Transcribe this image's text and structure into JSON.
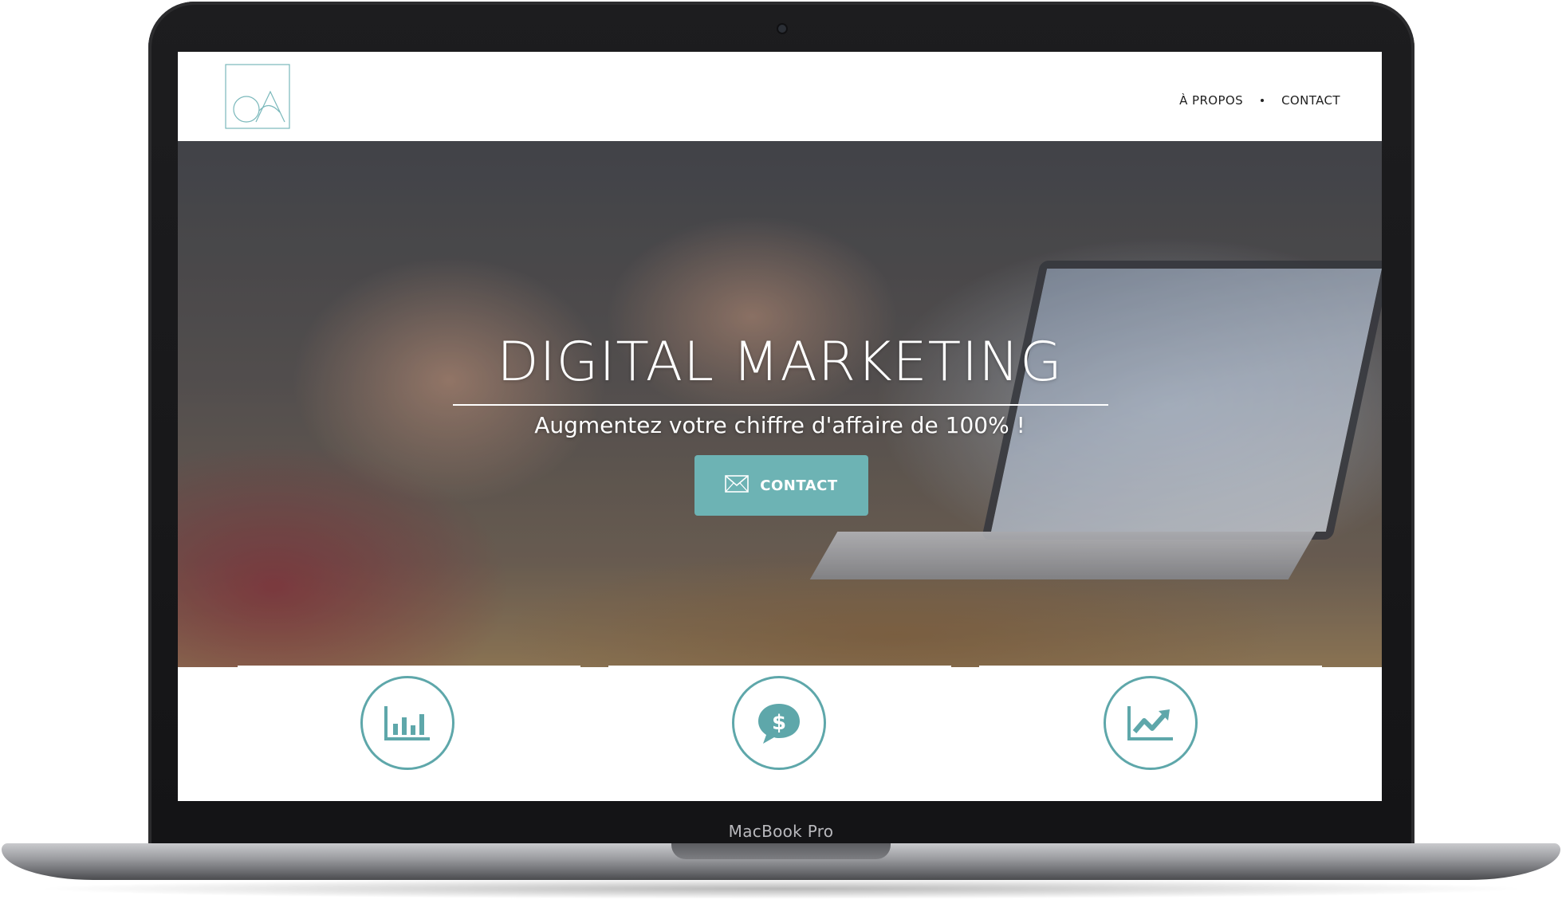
{
  "device": {
    "label": "MacBook Pro"
  },
  "header": {
    "logo_icon": "brand-logo-icon",
    "nav": [
      {
        "label": "À PROPOS"
      },
      {
        "label": "CONTACT"
      }
    ]
  },
  "hero": {
    "title": "DIGITAL MARKETING",
    "subtitle": "Augmentez votre chiffre d'affaire de 100% !",
    "cta": {
      "label": "CONTACT",
      "icon": "envelope-icon"
    }
  },
  "features": [
    {
      "icon": "bar-chart-icon"
    },
    {
      "icon": "dollar-chat-icon"
    },
    {
      "icon": "trend-up-icon"
    }
  ],
  "colors": {
    "accent": "#6db3b4",
    "icon_stroke": "#5ea7aa",
    "text_dark": "#1f1f1f"
  }
}
